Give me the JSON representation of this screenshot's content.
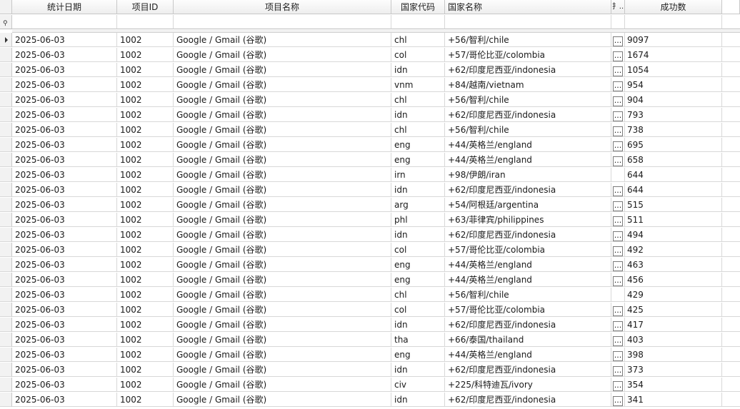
{
  "columns": [
    "统计日期",
    "项目ID",
    "项目名称",
    "国家代码",
    "国家名称",
    "扌..",
    "成功数"
  ],
  "filter_row": {
    "icon": "filter-icon"
  },
  "ellipsis": "...",
  "rows": [
    {
      "date": "2025-06-03",
      "pid": "1002",
      "name": "Google / Gmail (谷歌)",
      "code": "chl",
      "country": "+56/智利/chile",
      "btn": true,
      "count": "9097",
      "selected": true
    },
    {
      "date": "2025-06-03",
      "pid": "1002",
      "name": "Google / Gmail (谷歌)",
      "code": "col",
      "country": "+57/哥伦比亚/colombia",
      "btn": true,
      "count": "1674"
    },
    {
      "date": "2025-06-03",
      "pid": "1002",
      "name": "Google / Gmail (谷歌)",
      "code": "idn",
      "country": "+62/印度尼西亚/indonesia",
      "btn": true,
      "count": "1054"
    },
    {
      "date": "2025-06-03",
      "pid": "1002",
      "name": "Google / Gmail (谷歌)",
      "code": "vnm",
      "country": "+84/越南/vietnam",
      "btn": true,
      "count": "954"
    },
    {
      "date": "2025-06-03",
      "pid": "1002",
      "name": "Google / Gmail (谷歌)",
      "code": "chl",
      "country": "+56/智利/chile",
      "btn": true,
      "count": "904"
    },
    {
      "date": "2025-06-03",
      "pid": "1002",
      "name": "Google / Gmail (谷歌)",
      "code": "idn",
      "country": "+62/印度尼西亚/indonesia",
      "btn": true,
      "count": "793"
    },
    {
      "date": "2025-06-03",
      "pid": "1002",
      "name": "Google / Gmail (谷歌)",
      "code": "chl",
      "country": "+56/智利/chile",
      "btn": true,
      "count": "738"
    },
    {
      "date": "2025-06-03",
      "pid": "1002",
      "name": "Google / Gmail (谷歌)",
      "code": "eng",
      "country": "+44/英格兰/england",
      "btn": true,
      "count": "695"
    },
    {
      "date": "2025-06-03",
      "pid": "1002",
      "name": "Google / Gmail (谷歌)",
      "code": "eng",
      "country": "+44/英格兰/england",
      "btn": true,
      "count": "658"
    },
    {
      "date": "2025-06-03",
      "pid": "1002",
      "name": "Google / Gmail (谷歌)",
      "code": "irn",
      "country": "+98/伊朗/iran",
      "btn": false,
      "count": "644"
    },
    {
      "date": "2025-06-03",
      "pid": "1002",
      "name": "Google / Gmail (谷歌)",
      "code": "idn",
      "country": "+62/印度尼西亚/indonesia",
      "btn": true,
      "count": "644"
    },
    {
      "date": "2025-06-03",
      "pid": "1002",
      "name": "Google / Gmail (谷歌)",
      "code": "arg",
      "country": "+54/阿根廷/argentina",
      "btn": true,
      "count": "515"
    },
    {
      "date": "2025-06-03",
      "pid": "1002",
      "name": "Google / Gmail (谷歌)",
      "code": "phl",
      "country": "+63/菲律宾/philippines",
      "btn": true,
      "count": "511"
    },
    {
      "date": "2025-06-03",
      "pid": "1002",
      "name": "Google / Gmail (谷歌)",
      "code": "idn",
      "country": "+62/印度尼西亚/indonesia",
      "btn": true,
      "count": "494"
    },
    {
      "date": "2025-06-03",
      "pid": "1002",
      "name": "Google / Gmail (谷歌)",
      "code": "col",
      "country": "+57/哥伦比亚/colombia",
      "btn": true,
      "count": "492"
    },
    {
      "date": "2025-06-03",
      "pid": "1002",
      "name": "Google / Gmail (谷歌)",
      "code": "eng",
      "country": "+44/英格兰/england",
      "btn": true,
      "count": "463"
    },
    {
      "date": "2025-06-03",
      "pid": "1002",
      "name": "Google / Gmail (谷歌)",
      "code": "eng",
      "country": "+44/英格兰/england",
      "btn": true,
      "count": "456"
    },
    {
      "date": "2025-06-03",
      "pid": "1002",
      "name": "Google / Gmail (谷歌)",
      "code": "chl",
      "country": "+56/智利/chile",
      "btn": false,
      "count": "429"
    },
    {
      "date": "2025-06-03",
      "pid": "1002",
      "name": "Google / Gmail (谷歌)",
      "code": "col",
      "country": "+57/哥伦比亚/colombia",
      "btn": true,
      "count": "425"
    },
    {
      "date": "2025-06-03",
      "pid": "1002",
      "name": "Google / Gmail (谷歌)",
      "code": "idn",
      "country": "+62/印度尼西亚/indonesia",
      "btn": true,
      "count": "417"
    },
    {
      "date": "2025-06-03",
      "pid": "1002",
      "name": "Google / Gmail (谷歌)",
      "code": "tha",
      "country": "+66/泰国/thailand",
      "btn": true,
      "count": "403"
    },
    {
      "date": "2025-06-03",
      "pid": "1002",
      "name": "Google / Gmail (谷歌)",
      "code": "eng",
      "country": "+44/英格兰/england",
      "btn": true,
      "count": "398"
    },
    {
      "date": "2025-06-03",
      "pid": "1002",
      "name": "Google / Gmail (谷歌)",
      "code": "idn",
      "country": "+62/印度尼西亚/indonesia",
      "btn": true,
      "count": "373"
    },
    {
      "date": "2025-06-03",
      "pid": "1002",
      "name": "Google / Gmail (谷歌)",
      "code": "civ",
      "country": "+225/科特迪瓦/ivory",
      "btn": true,
      "count": "354"
    },
    {
      "date": "2025-06-03",
      "pid": "1002",
      "name": "Google / Gmail (谷歌)",
      "code": "idn",
      "country": "+62/印度尼西亚/indonesia",
      "btn": true,
      "count": "341"
    }
  ]
}
